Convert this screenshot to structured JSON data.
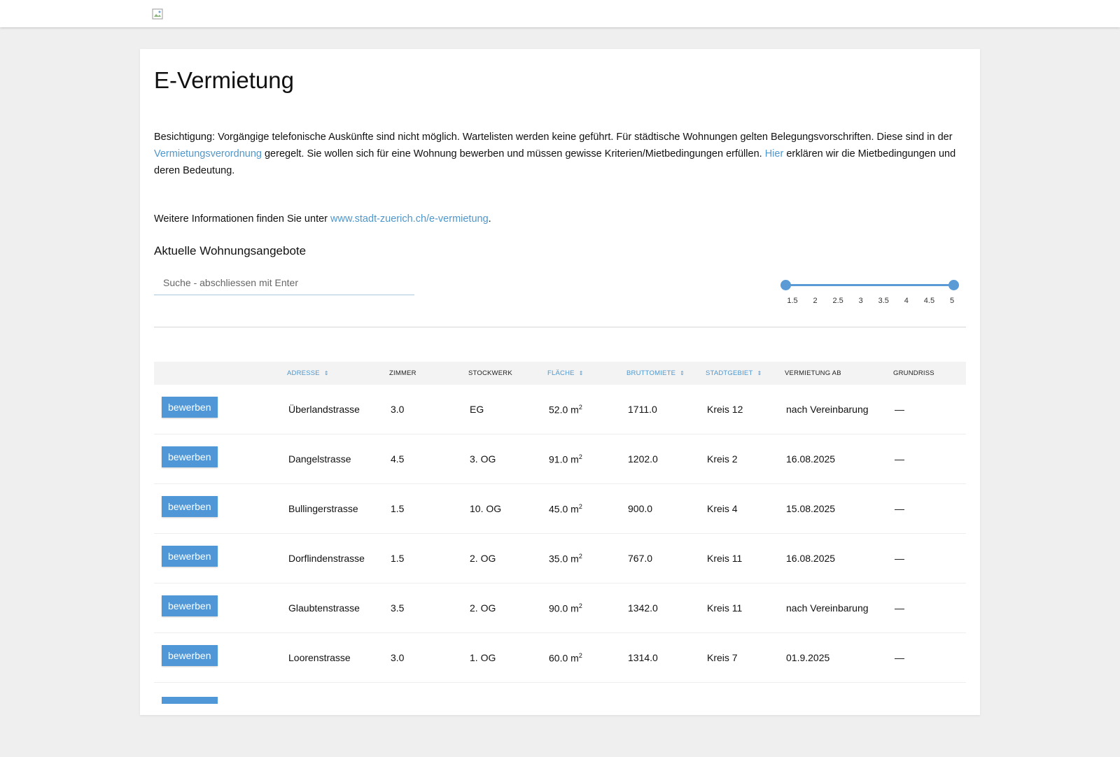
{
  "header": {
    "logo_icon": "broken-image-icon"
  },
  "page": {
    "title": "E-Vermietung",
    "para_part1": "Besichtigung: Vorgängige telefonische Auskünfte sind nicht möglich. Wartelisten werden keine geführt. Für städtische Wohnungen gelten Belegungsvorschriften. Diese sind in der ",
    "para_link1": "Vermie­tungsverordnung",
    "para_part2": " geregelt. Sie wollen sich für eine Wohnung bewerben und müssen gewisse Kriterien/Mietbedingungen erfüllen. ",
    "para_link2": "Hier",
    "para_part3": " erklären wir die Mietbedingungen und deren Bedeutung.",
    "info_prefix": "Weitere Informationen finden Sie unter ",
    "info_link": "www.stadt-zuerich.ch/e-vermietung",
    "info_suffix": ".",
    "subtitle": "Aktuelle Wohnungsangebote"
  },
  "search": {
    "placeholder": "Suche - abschliessen mit Enter",
    "value": ""
  },
  "room_filter": {
    "min": 1.5,
    "max": 5,
    "ticks": [
      "1.5",
      "2",
      "2.5",
      "3",
      "3.5",
      "4",
      "4.5",
      "5"
    ]
  },
  "table": {
    "headers": {
      "address": "Adresse",
      "rooms": "Zimmer",
      "floor": "Stockwerk",
      "area": "Fläche",
      "rent": "Bruttomiete",
      "district": "Stadtgebiet",
      "available": "Vermietung ab",
      "floorplan": "Grundriss"
    },
    "apply_label": "bewerben",
    "area_unit": "m",
    "area_exp": "2",
    "rows": [
      {
        "address": "Überlandstrasse",
        "rooms": "3.0",
        "floor": "EG",
        "area": "52.0",
        "rent": "1711.0",
        "district": "Kreis 12",
        "available": "nach Vereinbarung",
        "floorplan": "—"
      },
      {
        "address": "Dangelstrasse",
        "rooms": "4.5",
        "floor": "3. OG",
        "area": "91.0",
        "rent": "1202.0",
        "district": "Kreis 2",
        "available": "16.08.2025",
        "floorplan": "—"
      },
      {
        "address": "Bullingerstrasse",
        "rooms": "1.5",
        "floor": "10. OG",
        "area": "45.0",
        "rent": "900.0",
        "district": "Kreis 4",
        "available": "15.08.2025",
        "floorplan": "—"
      },
      {
        "address": "Dorflindenstrasse",
        "rooms": "1.5",
        "floor": "2. OG",
        "area": "35.0",
        "rent": "767.0",
        "district": "Kreis 11",
        "available": "16.08.2025",
        "floorplan": "—"
      },
      {
        "address": "Glaubtenstrasse",
        "rooms": "3.5",
        "floor": "2. OG",
        "area": "90.0",
        "rent": "1342.0",
        "district": "Kreis 11",
        "available": "nach Vereinbarung",
        "floorplan": "—"
      },
      {
        "address": "Loorenstrasse",
        "rooms": "3.0",
        "floor": "1. OG",
        "area": "60.0",
        "rent": "1314.0",
        "district": "Kreis 7",
        "available": "01.9.2025",
        "floorplan": "—"
      }
    ]
  },
  "colors": {
    "accent": "#4f97d6",
    "link": "#4f97cc",
    "background": "#efefef"
  }
}
